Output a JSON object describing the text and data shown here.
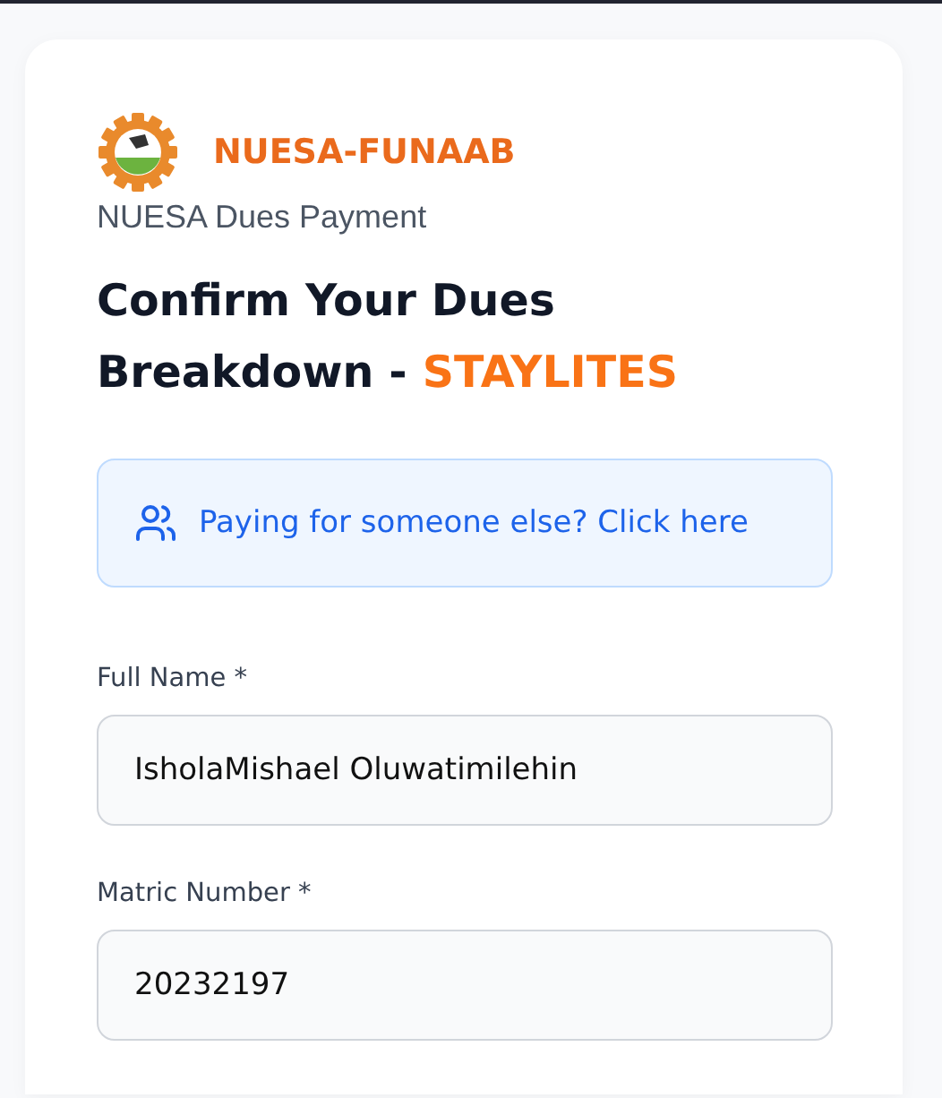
{
  "brand": {
    "name": "NUESA-FUNAAB",
    "subtitle": "NUESA Dues Payment"
  },
  "heading": {
    "text": "Confirm Your Dues Breakdown - ",
    "highlight": "STAYLITES"
  },
  "notice": {
    "label": "Paying for someone else? Click here"
  },
  "fields": [
    {
      "label": "Full Name *",
      "value": "IsholaMishael Oluwatimilehin"
    },
    {
      "label": "Matric Number *",
      "value": "20232197"
    }
  ]
}
